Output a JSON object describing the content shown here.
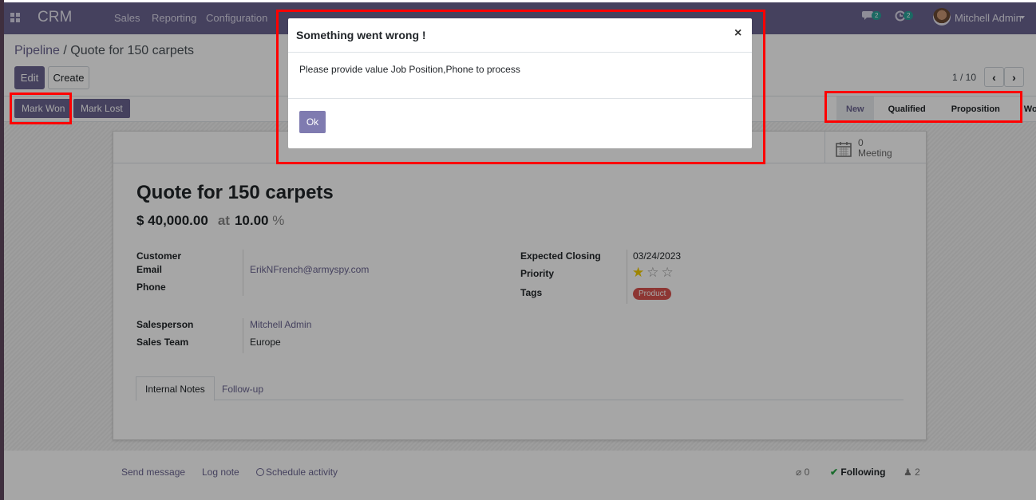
{
  "navbar": {
    "app_name": "CRM",
    "menu": [
      "Sales",
      "Reporting",
      "Configuration"
    ],
    "messages_count": "2",
    "activities_count": "2",
    "user_name": "Mitchell Admin"
  },
  "control": {
    "breadcrumb_parent": "Pipeline",
    "breadcrumb_sep": "/",
    "breadcrumb_current": "Quote for 150 carpets",
    "edit_label": "Edit",
    "create_label": "Create",
    "pager": "1 / 10"
  },
  "statusbar": {
    "mark_won": "Mark Won",
    "mark_lost": "Mark Lost",
    "stages": [
      "New",
      "Qualified",
      "Proposition",
      "Won"
    ],
    "active_stage": "New"
  },
  "form": {
    "meeting_count": "0",
    "meeting_label": "Meeting",
    "title": "Quote for 150 carpets",
    "revenue": "$ 40,000.00",
    "at": "at",
    "probability": "10.00",
    "percent": "%",
    "labels": {
      "customer": "Customer",
      "email": "Email",
      "phone": "Phone",
      "salesperson": "Salesperson",
      "sales_team": "Sales Team",
      "expected_closing": "Expected Closing",
      "priority": "Priority",
      "tags": "Tags"
    },
    "values": {
      "email": "ErikNFrench@armyspy.com",
      "salesperson": "Mitchell Admin",
      "sales_team": "Europe",
      "expected_closing": "03/24/2023",
      "priority_stars": 1,
      "priority_max": 3,
      "tag": "Product"
    },
    "tabs": [
      "Internal Notes",
      "Follow-up"
    ]
  },
  "chatter": {
    "send_message": "Send message",
    "log_note": "Log note",
    "schedule_activity": "Schedule activity",
    "attachments": "0",
    "following": "Following",
    "followers": "2"
  },
  "modal": {
    "title": "Something went wrong !",
    "close": "×",
    "message": "Please provide value Job Position,Phone to process",
    "ok_label": "Ok"
  },
  "colors": {
    "brand": "#6a6591",
    "highlight": "#ff0000",
    "tag": "#d9534f",
    "star": "#f3cc00"
  }
}
